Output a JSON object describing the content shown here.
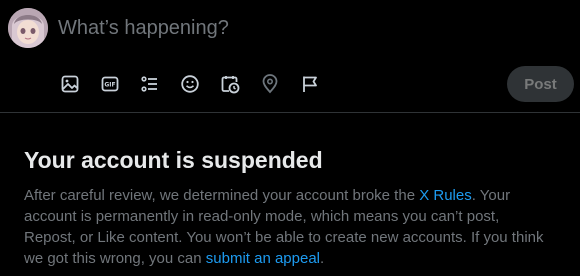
{
  "composer": {
    "placeholder": "What’s happening?",
    "post_label": "Post",
    "tools": [
      {
        "icon": "image-icon"
      },
      {
        "icon": "gif-icon",
        "label": "GIF"
      },
      {
        "icon": "poll-icon"
      },
      {
        "icon": "emoji-icon"
      },
      {
        "icon": "schedule-icon"
      },
      {
        "icon": "location-icon"
      },
      {
        "icon": "flag-icon"
      }
    ]
  },
  "notice": {
    "title": "Your account is suspended",
    "body_part1": "After careful review, we determined your account broke the ",
    "rules_link": "X Rules",
    "body_part2": ". Your account is permanently in read-only mode, which means you can’t post, Repost, or Like content. You won’t be able to create new accounts. If you think we got this wrong, you can ",
    "appeal_link": "submit an appeal",
    "body_part3": "."
  },
  "colors": {
    "background": "#000000",
    "icon_accent": "#c9d1d9",
    "link": "#1d9bf0",
    "muted_text": "#71767b",
    "post_button_bg": "#2f3336"
  }
}
